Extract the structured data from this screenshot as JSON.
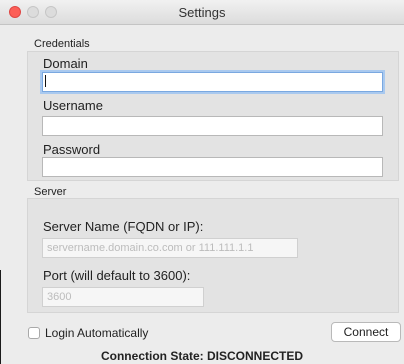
{
  "window": {
    "title": "Settings"
  },
  "credentials": {
    "section_label": "Credentials",
    "domain": {
      "label": "Domain",
      "value": "",
      "placeholder": ""
    },
    "username": {
      "label": "Username",
      "value": "",
      "placeholder": ""
    },
    "password": {
      "label": "Password",
      "value": "",
      "placeholder": ""
    }
  },
  "server": {
    "section_label": "Server",
    "server_name": {
      "label": "Server Name (FQDN or IP):",
      "placeholder": "servername.domain.co.com or 111.111.1.1"
    },
    "port": {
      "label": "Port (will default to 3600):",
      "placeholder": "3600"
    }
  },
  "footer": {
    "login_automatically": {
      "label": "Login Automatically",
      "checked": false
    },
    "connect_label": "Connect",
    "status_text": "Connection State: DISCONNECTED"
  },
  "colors": {
    "close": "#fc5f57",
    "focus_ring": "#a9c9ef",
    "window_bg": "#ececec",
    "group_bg": "#e3e3e3"
  },
  "icons": [
    "close-window-icon",
    "minimize-window-icon",
    "zoom-window-icon",
    "checkbox-icon"
  ]
}
